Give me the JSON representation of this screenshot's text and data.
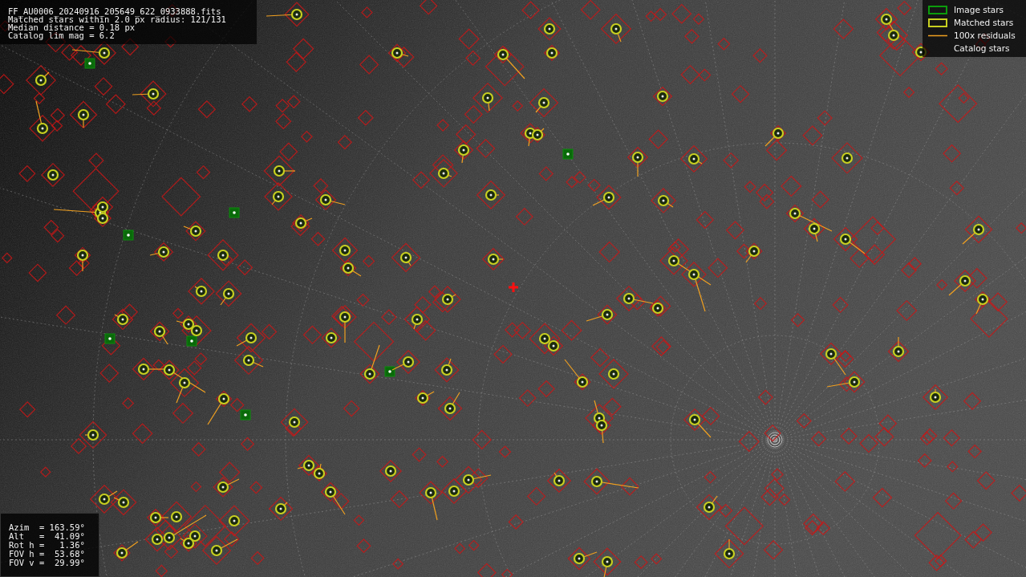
{
  "info_lines": [
    "FF_AU0006_20240916_205649_622_0933888.fits",
    "Matched stars within 2.0 px radius: 121/131",
    "Median distance = 0.18 px",
    "Catalog lim mag = 6.2"
  ],
  "legend": [
    {
      "kind": "image",
      "label": "Image stars"
    },
    {
      "kind": "matched",
      "label": "Matched stars"
    },
    {
      "kind": "residual",
      "label": "100x residuals"
    },
    {
      "kind": "catalog",
      "label": "Catalog stars"
    }
  ],
  "pointing": [
    "Azim  = 163.59°",
    "Alt   =  41.09°",
    "Rot h =   1.36°",
    "FOV h =  53.68°",
    "FOV v =  29.99°"
  ]
}
